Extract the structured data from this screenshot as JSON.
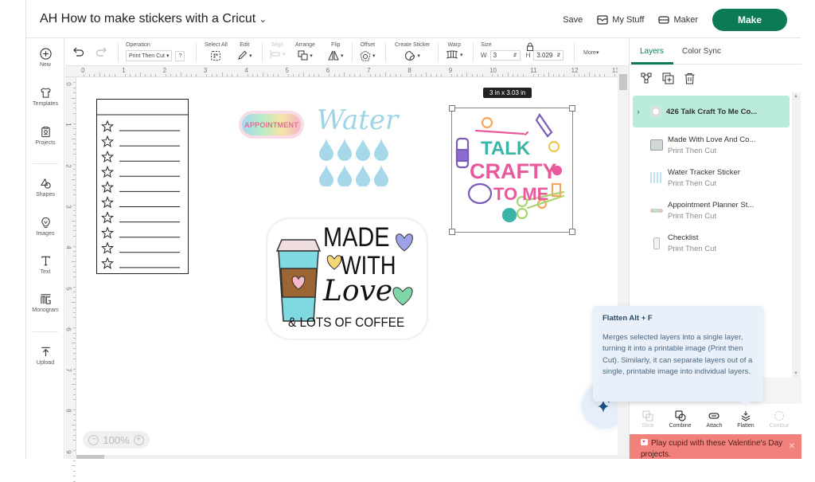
{
  "header": {
    "project_title": "AH How to make stickers with a Cricut",
    "save_label": "Save",
    "my_stuff_label": "My Stuff",
    "maker_label": "Maker",
    "make_label": "Make"
  },
  "sidebar": {
    "items": [
      {
        "label": "New",
        "icon": "plus-circle-icon"
      },
      {
        "label": "Templates",
        "icon": "shirt-icon"
      },
      {
        "label": "Projects",
        "icon": "projects-icon"
      },
      {
        "label": "Shapes",
        "icon": "shapes-icon"
      },
      {
        "label": "Images",
        "icon": "lightbulb-icon"
      },
      {
        "label": "Text",
        "icon": "text-icon"
      },
      {
        "label": "Monogram",
        "icon": "monogram-icon"
      },
      {
        "label": "Upload",
        "icon": "upload-icon"
      }
    ]
  },
  "toolbar": {
    "operation_label": "Operation",
    "operation_value": "Print Then Cut",
    "help_label": "?",
    "select_all_label": "Select All",
    "edit_label": "Edit",
    "align_label": "Align",
    "arrange_label": "Arrange",
    "flip_label": "Flip",
    "offset_label": "Offset",
    "create_sticker_label": "Create Sticker",
    "warp_label": "Warp",
    "size_label": "Size",
    "width_label": "W",
    "width_value": "3",
    "height_label": "H",
    "height_value": "3.029",
    "more_label": "More"
  },
  "rulers": {
    "top": [
      "0",
      "1",
      "2",
      "3",
      "4",
      "5",
      "6",
      "7",
      "8",
      "9",
      "10",
      "11",
      "12",
      "13"
    ],
    "left": [
      "0",
      "1",
      "2",
      "3",
      "4",
      "5",
      "6",
      "7",
      "8",
      "9"
    ]
  },
  "canvas": {
    "zoom_level": "100%",
    "selection_dimensions": "3  in x 3.03  in",
    "stickers": {
      "appointment_text": "APPOINTMENT",
      "water_text": "Water",
      "talk_craft_lines": [
        "TALK",
        "CRAFTY",
        "TO ME"
      ],
      "made_with_lines": [
        "MADE",
        "WITH",
        "Love",
        "& LOTS OF COFFEE"
      ],
      "checklist_rows": 10
    }
  },
  "panel": {
    "tabs": [
      {
        "label": "Layers",
        "active": true
      },
      {
        "label": "Color Sync",
        "active": false
      }
    ],
    "layers": [
      {
        "name": "426 Talk Craft To Me Co...",
        "sub": "",
        "selected": true,
        "expandable": true
      },
      {
        "name": "Made With Love And Co...",
        "sub": "Print Then Cut",
        "selected": false
      },
      {
        "name": "Water Tracker Sticker",
        "sub": "Print Then Cut",
        "selected": false
      },
      {
        "name": "Appointment Planner St...",
        "sub": "Print Then Cut",
        "selected": false
      },
      {
        "name": "Checklist",
        "sub": "Print Then Cut",
        "selected": false
      }
    ],
    "bottom_tools": [
      {
        "label": "Slice",
        "enabled": false
      },
      {
        "label": "Combine",
        "enabled": true
      },
      {
        "label": "Attach",
        "enabled": true
      },
      {
        "label": "Flatten",
        "enabled": true
      },
      {
        "label": "Contour",
        "enabled": false
      }
    ],
    "promo_text": "Play cupid with these Valentine's Day projects."
  },
  "tooltip": {
    "title": "Flatten Alt + F",
    "body": "Merges selected layers into a single layer, turning it into a printable image (Print then Cut). Similarly, it can separate layers out of a single, printable image into individual layers."
  },
  "colors": {
    "brand_green": "#0c7a55",
    "selected_layer": "#b9eadb",
    "promo_bg": "#f2817b",
    "tooltip_bg": "#e9f0f9"
  }
}
